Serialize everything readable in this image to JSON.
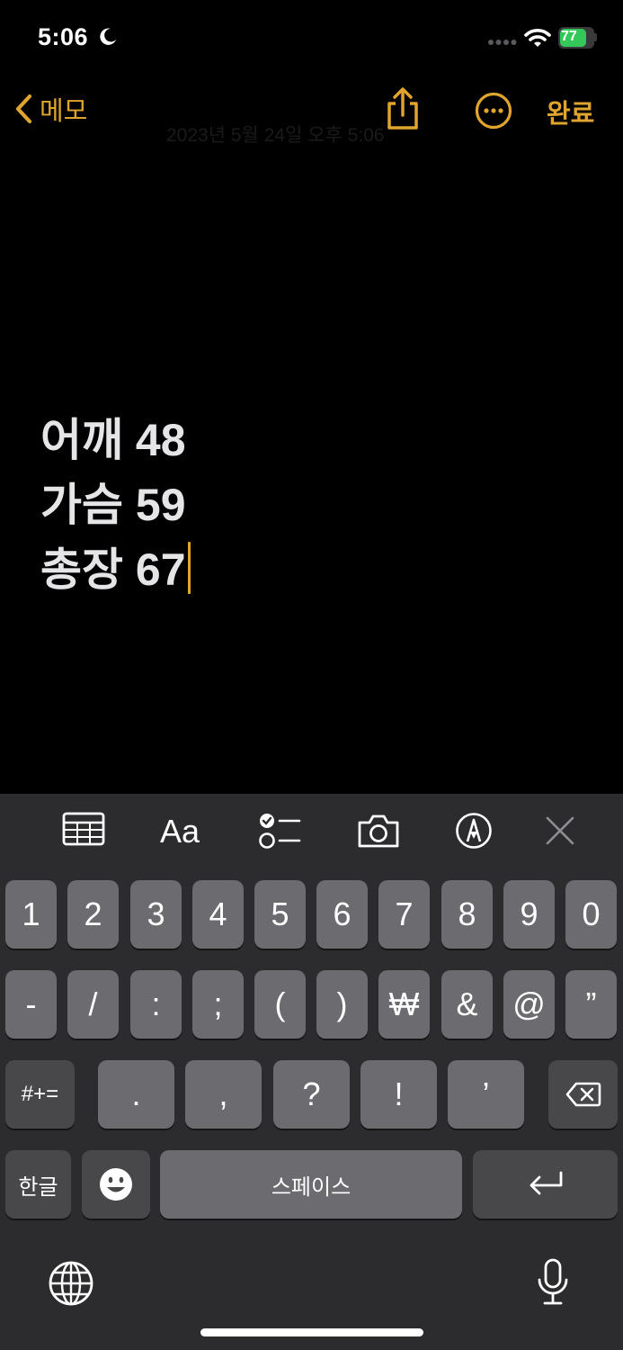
{
  "status_bar": {
    "time": "5:06",
    "battery": "77"
  },
  "nav": {
    "back_label": "메모",
    "date": "2023년 5월 24일 오후 5:06",
    "done_label": "완료"
  },
  "note": {
    "lines": [
      "어깨 48",
      "가슴 59",
      "총장 67"
    ]
  },
  "toolbar": {
    "format_label": "Aa"
  },
  "keyboard": {
    "row1": [
      "1",
      "2",
      "3",
      "4",
      "5",
      "6",
      "7",
      "8",
      "9",
      "0"
    ],
    "row2": [
      "-",
      "/",
      ":",
      ";",
      "(",
      ")",
      "₩",
      "&",
      "@",
      "”"
    ],
    "row3_mode": "#+=",
    "row3": [
      ".",
      ",",
      "?",
      "!",
      "’"
    ],
    "lang_label": "한글",
    "space_label": "스페이스"
  },
  "colors": {
    "accent": "#e0a52c",
    "battery": "#34c759",
    "key": "#6c6c70",
    "key_dark": "#48484a",
    "keyboard_bg": "#2c2c2e"
  },
  "icons": [
    "moon-icon",
    "cellular-dots-icon",
    "wifi-icon",
    "battery-icon",
    "chevron-left-icon",
    "share-icon",
    "more-icon",
    "table-icon",
    "checklist-icon",
    "camera-icon",
    "markup-pen-icon",
    "close-icon",
    "delete-icon",
    "emoji-icon",
    "return-icon",
    "globe-icon",
    "microphone-icon"
  ]
}
